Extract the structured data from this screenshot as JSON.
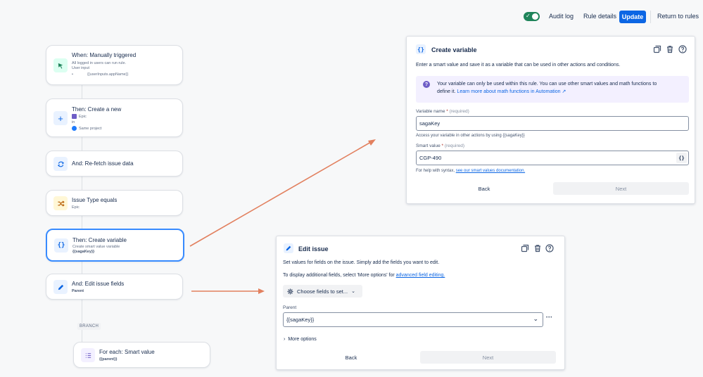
{
  "header": {
    "audit_log": "Audit log",
    "rule_details": "Rule details",
    "update": "Update",
    "return_to_rules": "Return to rules"
  },
  "flow": {
    "trigger": {
      "title": "When: Manually triggered",
      "line1": "All logged in users can run rule.",
      "line2": "User input",
      "line3": "{{userInputs.appName}}"
    },
    "create_new": {
      "title": "Then: Create a new",
      "type": "Epic",
      "in": "in",
      "project": "Same project"
    },
    "refetch": {
      "title": "And: Re-fetch issue data"
    },
    "condition": {
      "title": "Issue Type equals",
      "value": "Epic"
    },
    "create_variable": {
      "title": "Then: Create variable",
      "line1": "Create smart value variable",
      "line2": "{{sagaKey}}"
    },
    "edit_fields": {
      "title": "And: Edit issue fields",
      "line1": "Parent"
    },
    "branch_label": "BRANCH",
    "for_each": {
      "title": "For each: Smart value",
      "line1": "{{parent}}"
    }
  },
  "create_variable_panel": {
    "title": "Create variable",
    "description": "Enter a smart value and save it as a variable that can be used in other actions and conditions.",
    "info_line1": "Your variable can only be used within this rule. You can use other smart values and math functions to",
    "info_line2": "define it.",
    "info_link": "Learn more about math functions in Automation ↗",
    "variable_name_label": "Variable name",
    "required_star": "*",
    "required_text": "(required)",
    "variable_name_value": "sagaKey",
    "variable_hint": "Access your variable in other actions by using {{sagaKey}}",
    "smart_value_label": "Smart value",
    "smart_value_value": "CGP-490",
    "smart_value_button": "{}",
    "syntax_help": "For help with syntax,",
    "syntax_link": "see our smart values documentation.",
    "back": "Back",
    "next": "Next"
  },
  "edit_issue_panel": {
    "title": "Edit issue",
    "description1": "Set values for fields on the issue. Simply add the fields you want to edit.",
    "description2": "To display additional fields, select 'More options' for",
    "advanced_link": "advanced field editing.",
    "choose_fields": "Choose fields to set...",
    "parent_label": "Parent",
    "parent_value": "{{sagaKey}}",
    "more_dots": "•••",
    "more_options": "More options",
    "back": "Back",
    "next": "Next"
  },
  "colors": {
    "accent": "#0c66e4",
    "selected_border": "#388bff",
    "toggle_on": "#1f845a",
    "arrow": "#e2805f",
    "info_bg": "#f3f0ff"
  }
}
